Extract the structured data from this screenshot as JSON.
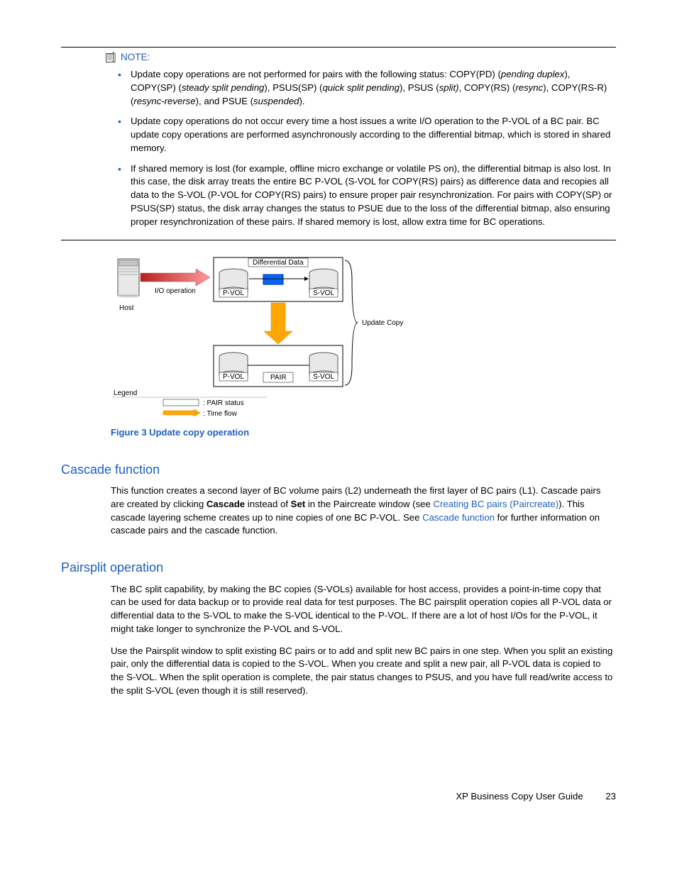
{
  "note": {
    "label": "NOTE:",
    "bullets": {
      "b1": {
        "t1": "Update copy operations are not performed for pairs with the following status: COPY(PD) (",
        "i1": "pending duplex",
        "t2": "), COPY(SP) (",
        "i2": "steady split pending",
        "t3": "), PSUS(SP) (",
        "i3": "quick split pending",
        "t4": "), PSUS (",
        "i4": "split)",
        "t5": ", COPY(RS) (",
        "i5": "resync",
        "t6": "), COPY(RS-R) (",
        "i6": "resync-reverse",
        "t7": "), and PSUE (",
        "i7": "suspended",
        "t8": ")."
      },
      "b2": "Update copy operations do not occur every time a host issues a write I/O operation to the P-VOL of a BC pair. BC update copy operations are performed asynchronously according to the differential bitmap, which is stored in shared memory.",
      "b3": "If shared memory is lost (for example, offline micro exchange or volatile PS on), the differential bitmap is also lost. In this case, the disk array treats the entire BC P-VOL (S-VOL for COPY(RS) pairs) as difference data and recopies all data to the S-VOL (P-VOL for COPY(RS) pairs) to ensure proper pair resynchronization. For pairs with COPY(SP) or PSUS(SP) status, the disk array changes the status to PSUE due to the loss of the differential bitmap, also ensuring proper resynchronization of these pairs. If shared memory is lost, allow extra time for BC operations."
    }
  },
  "figure": {
    "host": "Host",
    "io": "I/O operation",
    "diff": "Differential Data",
    "pvol": "P-VOL",
    "svol": "S-VOL",
    "pair": "PAIR",
    "update": "Update Copy",
    "legend": "Legend",
    "leg1": ": PAIR status",
    "leg2": ": Time flow",
    "caption": "Figure 3 Update copy operation"
  },
  "cascade": {
    "head": "Cascade function",
    "p": {
      "t1": "This function creates a second layer of BC volume pairs (L2) underneath the first layer of BC pairs (L1). Cascade pairs are created by clicking ",
      "b1": "Cascade",
      "t2": " instead of ",
      "b2": "Set",
      "t3": " in the Paircreate window (see ",
      "l1": "Creating BC pairs (Paircreate)",
      "t4": "). This cascade layering scheme creates up to nine copies of one BC P-VOL. See ",
      "l2": "Cascade function",
      "t5": " for further information on cascade pairs and the cascade function."
    }
  },
  "pairsplit": {
    "head": "Pairsplit operation",
    "p1": "The BC split capability, by making the BC copies (S-VOLs) available for host access, provides a point-in-time copy that can be used for data backup or to provide real data for test purposes. The BC pairsplit operation copies all P-VOL data or differential data to the S-VOL to make the S-VOL identical to the P-VOL. If there are a lot of host I/Os for the P-VOL, it might take longer to synchronize the P-VOL and S-VOL.",
    "p2": "Use the Pairsplit window to split existing BC pairs or to add and split new BC pairs in one step. When you split an existing pair, only the differential data is copied to the S-VOL. When you create and split a new pair, all P-VOL data is copied to the S-VOL. When the split operation is complete, the pair status changes to PSUS, and you have full read/write access to the split S-VOL (even though it is still reserved)."
  },
  "footer": {
    "title": "XP Business Copy User Guide",
    "page": "23"
  }
}
